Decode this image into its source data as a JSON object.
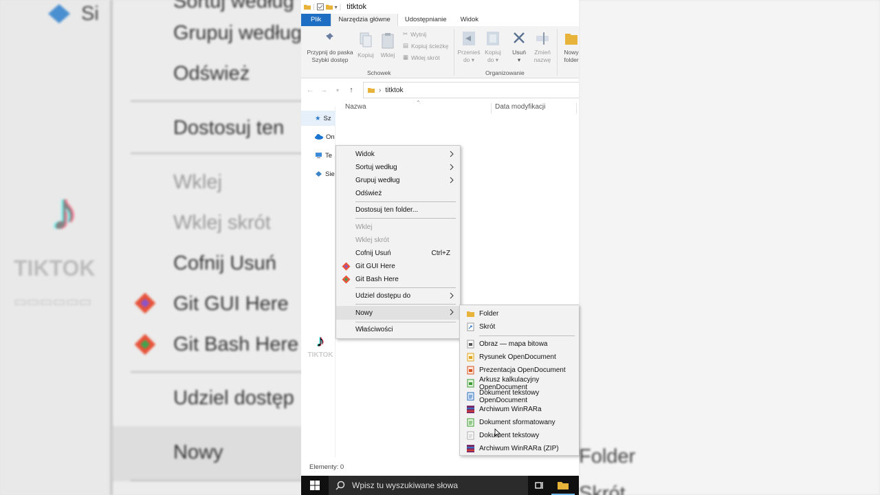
{
  "background": {
    "items": [
      {
        "label": "Grupuj według",
        "dim": false
      },
      {
        "label": "Odśwież",
        "dim": false
      },
      {
        "label": "Dostosuj ten",
        "dim": false
      },
      {
        "label": "Wklej",
        "dim": true
      },
      {
        "label": "Wklej skrót",
        "dim": true
      },
      {
        "label": "Cofnij Usuń",
        "dim": false
      },
      {
        "label": "Git GUI Here",
        "dim": false
      },
      {
        "label": "Git Bash Here",
        "dim": false
      },
      {
        "label": "Udziel dostęp",
        "dim": false
      },
      {
        "label": "Nowy",
        "dim": false
      }
    ],
    "top_partial": "Sortuj według",
    "left_partial": "Si",
    "tiktok_text": "TIKTOK",
    "right_folder": "Folder",
    "right_partial": "Skrót"
  },
  "window": {
    "title": "titktok",
    "tabs": {
      "file": "Plik",
      "home": "Narzędzia główne",
      "share": "Udostępnianie",
      "view": "Widok"
    },
    "ribbon": {
      "pin_line1": "Przypnij do paska",
      "pin_line2": "Szybki dostęp",
      "copy": "Kopiuj",
      "paste": "Wklej",
      "cut": "Wytnij",
      "copy_path": "Kopiuj ścieżkę",
      "paste_shortcut": "Wklej skrót",
      "clipboard_group": "Schowek",
      "move_line1": "Przenieś",
      "move_line2": "do",
      "copyto_line1": "Kopiuj",
      "copyto_line2": "do",
      "delete": "Usuń",
      "rename_line1": "Zmień",
      "rename_line2": "nazwę",
      "organize_group": "Organizowanie",
      "newfolder_line1": "Nowy",
      "newfolder_line2": "folder"
    },
    "path": "titktok",
    "columns": {
      "name": "Nazwa",
      "date": "Data modyfikacji"
    },
    "nav": [
      "Sz",
      "On",
      "Te",
      "Sie"
    ],
    "file_label": "TIKTOK",
    "status": "Elementy: 0"
  },
  "taskbar": {
    "search_placeholder": "Wpisz tu wyszukiwane słowa"
  },
  "context_menu": {
    "view": "Widok",
    "sort": "Sortuj według",
    "group": "Grupuj według",
    "refresh": "Odśwież",
    "customize": "Dostosuj ten folder...",
    "paste": "Wklej",
    "paste_shortcut": "Wklej skrót",
    "undo": "Cofnij Usuń",
    "undo_shortcut": "Ctrl+Z",
    "git_gui": "Git GUI Here",
    "git_bash": "Git Bash Here",
    "share": "Udziel dostępu do",
    "new": "Nowy",
    "properties": "Właściwości"
  },
  "new_submenu": {
    "folder": "Folder",
    "shortcut": "Skrót",
    "bitmap": "Obraz — mapa bitowa",
    "odg": "Rysunek OpenDocument",
    "odp": "Prezentacja OpenDocument",
    "ods": "Arkusz kalkulacyjny OpenDocument",
    "odt": "Dokument tekstowy OpenDocument",
    "rar": "Archiwum WinRARa",
    "rtf": "Dokument sformatowany",
    "txt": "Dokument tekstowy",
    "zip": "Archiwum WinRARa (ZIP)"
  },
  "colors": {
    "accent": "#1e6fc3",
    "menu_bg": "#f2f2f2",
    "highlight": "#e1e1e1",
    "taskbar": "#101010"
  }
}
